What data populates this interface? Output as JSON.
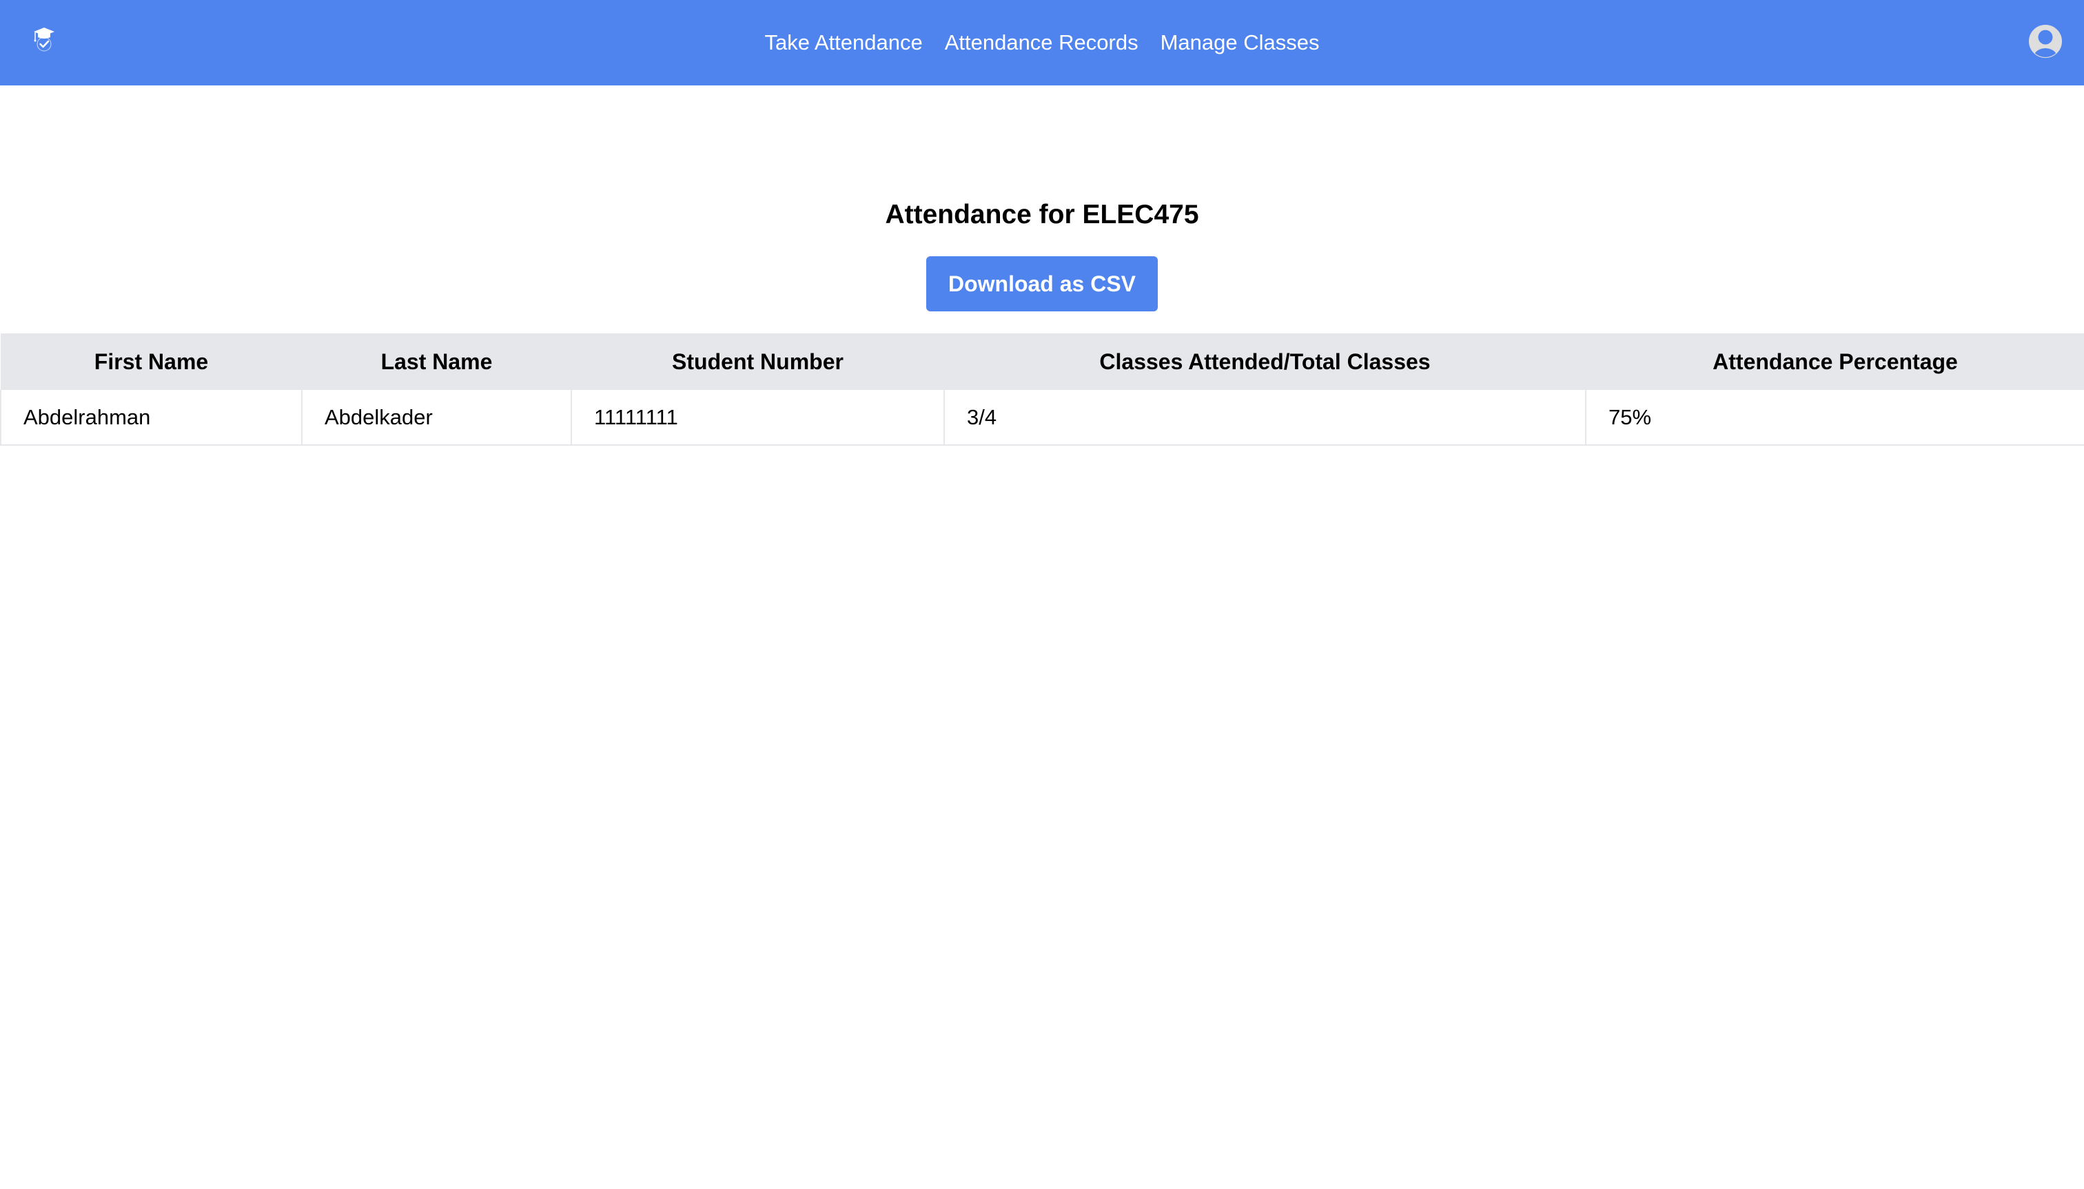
{
  "navbar": {
    "logo_icon": "graduation-cap-check-icon",
    "links": [
      {
        "label": "Take Attendance"
      },
      {
        "label": "Attendance Records"
      },
      {
        "label": "Manage Classes"
      }
    ],
    "avatar_icon": "user-avatar-icon",
    "colors": {
      "background": "#4f83ee",
      "text": "#ffffff"
    }
  },
  "main": {
    "title": "Attendance for ELEC475",
    "download_button_label": "Download as CSV",
    "table": {
      "headers": [
        "First Name",
        "Last Name",
        "Student Number",
        "Classes Attended/Total Classes",
        "Attendance Percentage"
      ],
      "rows": [
        [
          "Abdelrahman",
          "Abdelkader",
          "11111111",
          "3/4",
          "75%"
        ]
      ],
      "colors": {
        "header_bg": "#e5e7eb",
        "border": "#e5e7eb"
      }
    }
  }
}
